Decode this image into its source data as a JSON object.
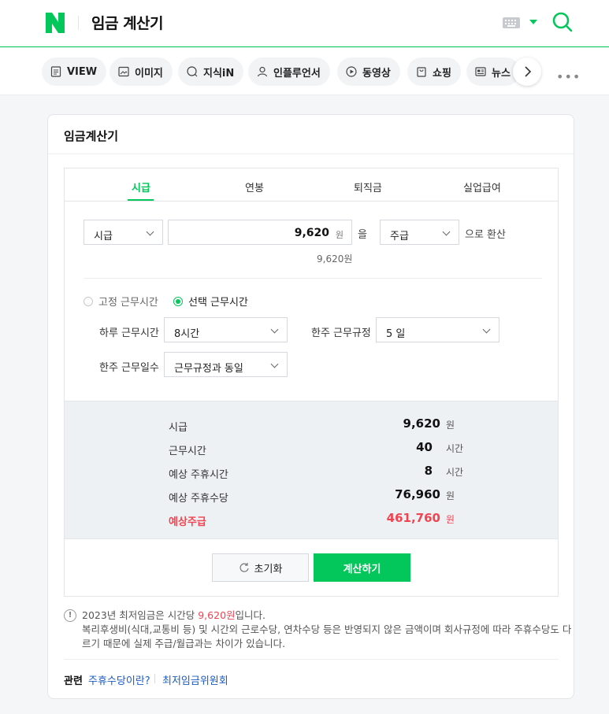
{
  "header": {
    "query": "임금 계산기"
  },
  "tabs": [
    {
      "label": "VIEW",
      "icon": "document-icon"
    },
    {
      "label": "이미지",
      "icon": "image-icon"
    },
    {
      "label": "지식iN",
      "icon": "qa-icon"
    },
    {
      "label": "인플루언서",
      "icon": "person-icon"
    },
    {
      "label": "동영상",
      "icon": "play-icon"
    },
    {
      "label": "쇼핑",
      "icon": "bag-icon"
    },
    {
      "label": "뉴스",
      "icon": "news-icon"
    }
  ],
  "card": {
    "title": "임금계산기"
  },
  "calc_tabs": [
    "시급",
    "연봉",
    "퇴직금",
    "실업급여"
  ],
  "converter": {
    "from_unit": "시급",
    "amount": "9,620",
    "amount_unit": "원",
    "particle": "을",
    "to_unit": "주급",
    "suffix": "으로 환산",
    "amount_text": "9,620원"
  },
  "mode": {
    "fixed": "고정 근무시간",
    "selected": "선택 근무시간"
  },
  "fields": {
    "daily_hours_label": "하루 근무시간",
    "daily_hours": "8시간",
    "weekly_rule_label": "한주 근무규정",
    "weekly_rule": "5 일",
    "weekly_days_label": "한주 근무일수",
    "weekly_days": "근무규정과 동일"
  },
  "results": [
    {
      "label": "시급",
      "value": "9,620",
      "unit": "원"
    },
    {
      "label": "근무시간",
      "value": "40",
      "unit": "시간"
    },
    {
      "label": "예상 주휴시간",
      "value": "8",
      "unit": "시간"
    },
    {
      "label": "예상 주휴수당",
      "value": "76,960",
      "unit": "원"
    },
    {
      "label": "예상주급",
      "value": "461,760",
      "unit": "원"
    }
  ],
  "buttons": {
    "reset": "초기화",
    "calculate": "계산하기"
  },
  "notes": {
    "line1_pre": "2023년 최저임금은 시간당 ",
    "line1_highlight": "9,620원",
    "line1_post": "입니다.",
    "line2": "복리후생비(식대,교통비 등) 및 시간외 근로수당, 연차수당 등은 반영되지 않은 금액이며 회사규정에 따라 주휴수당도 다",
    "line3": "르기 때문에 실제 주급/월급과는 차이가 있습니다."
  },
  "related": {
    "label": "관련",
    "links": [
      "주휴수당이란?",
      "최저임금위원회"
    ]
  },
  "colors": {
    "brand": "#03c75a",
    "highlight": "#f24350",
    "link": "#1a5bc4"
  }
}
